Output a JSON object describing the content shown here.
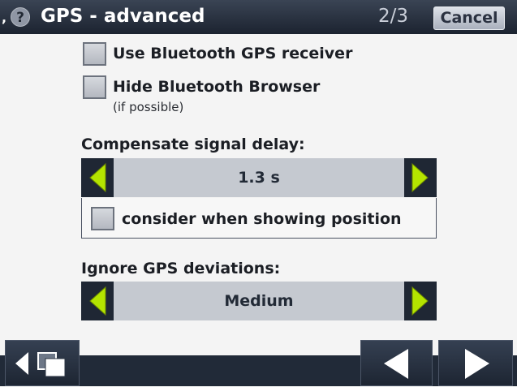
{
  "header": {
    "tick": ",",
    "help_glyph": "?",
    "title": "GPS - advanced",
    "page_indicator": "2/3",
    "cancel_label": "Cancel"
  },
  "options": {
    "use_bt_receiver": {
      "label": "Use Bluetooth GPS receiver",
      "checked": false
    },
    "hide_bt_browser": {
      "label": "Hide Bluetooth Browser",
      "sublabel": "(if possible)",
      "checked": false
    }
  },
  "signal_delay": {
    "heading": "Compensate signal delay:",
    "value": "1.3 s",
    "consider_label": "consider when showing position",
    "consider_checked": false
  },
  "deviations": {
    "heading": "Ignore GPS deviations:",
    "value": "Medium"
  },
  "footer": {
    "left_icon": "switch-windows-icon",
    "back_icon": "back-arrow-icon",
    "next_icon": "next-arrow-icon"
  },
  "colors": {
    "arrow_green": "#b4e400",
    "bar_dark": "#1f2734",
    "selector_bg": "#c5c9d0"
  }
}
